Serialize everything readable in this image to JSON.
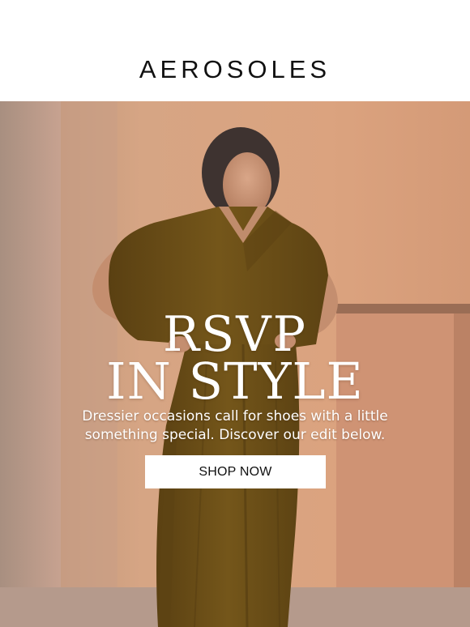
{
  "brand": {
    "logo_text": "AEROSOLES"
  },
  "hero": {
    "headline_line1": "RSVP",
    "headline_line2": "IN STYLE",
    "subtext_line1": "Dressier occasions call for shoes with a little",
    "subtext_line2": "something special. Discover our edit below.",
    "cta_label": "SHOP NOW"
  },
  "colors": {
    "background": "#ffffff",
    "wall": "#d9a07e",
    "dress": "#6e5018",
    "text_on_photo": "#ffffff"
  }
}
